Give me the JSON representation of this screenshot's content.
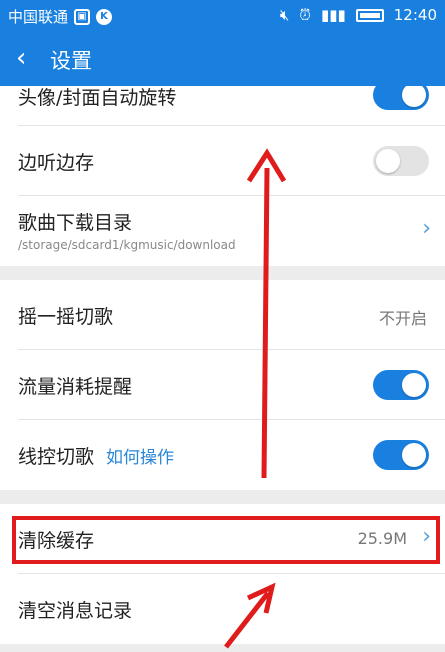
{
  "status_bar": {
    "carrier": "中国联通",
    "time": "12:40"
  },
  "header": {
    "title": "设置"
  },
  "rows": {
    "avatar_rotate": {
      "label": "头像/封面自动旋转",
      "toggle": "on"
    },
    "listen_save": {
      "label": "边听边存",
      "toggle": "off"
    },
    "download_dir": {
      "label": "歌曲下载目录",
      "path": "/storage/sdcard1/kgmusic/download"
    },
    "shake": {
      "label": "摇一摇切歌",
      "value": "不开启"
    },
    "traffic": {
      "label": "流量消耗提醒",
      "toggle": "on"
    },
    "wire_control": {
      "label": "线控切歌",
      "link": "如何操作",
      "toggle": "on"
    },
    "clear_cache": {
      "label": "清除缓存",
      "value": "25.9M"
    },
    "clear_messages": {
      "label": "清空消息记录"
    }
  },
  "colors": {
    "accent": "#1a80e0",
    "annotation_red": "#e01b1b"
  }
}
